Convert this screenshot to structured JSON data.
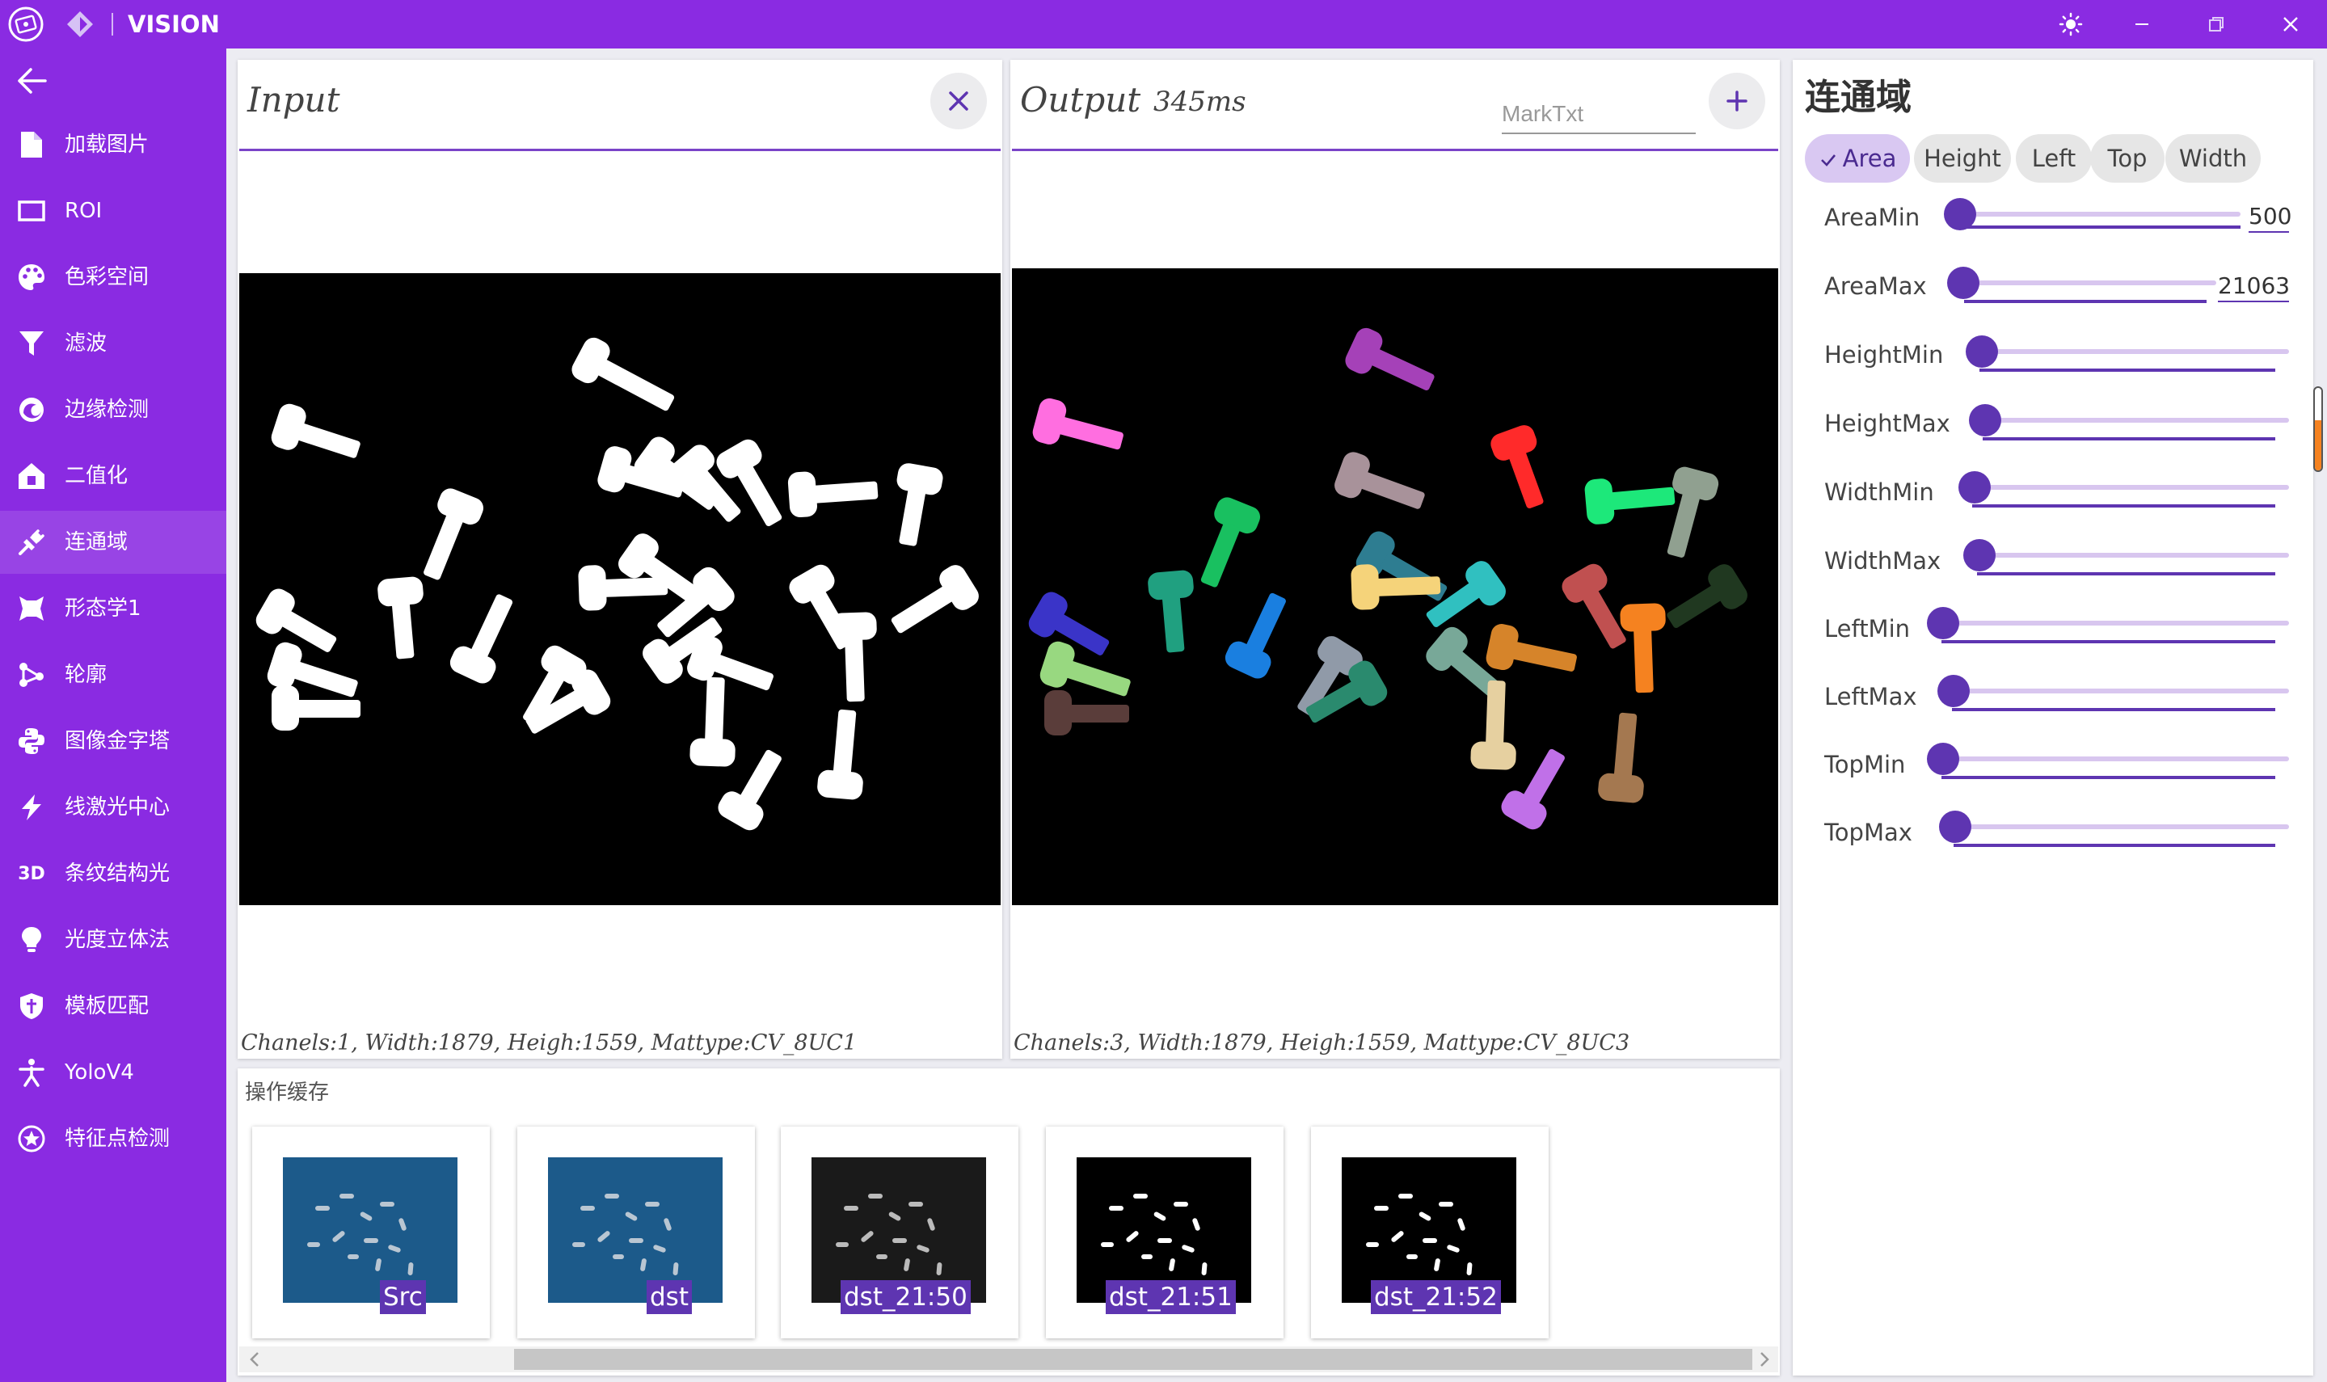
{
  "app": {
    "title": "VISION"
  },
  "sidebar": {
    "items": [
      {
        "label": "加载图片",
        "icon": "file-icon"
      },
      {
        "label": "ROI",
        "icon": "rectangle-icon"
      },
      {
        "label": "色彩空间",
        "icon": "palette-icon"
      },
      {
        "label": "滤波",
        "icon": "filter-icon"
      },
      {
        "label": "边缘检测",
        "icon": "edge-icon"
      },
      {
        "label": "二值化",
        "icon": "home-icon"
      },
      {
        "label": "连通域",
        "icon": "plug-icon"
      },
      {
        "label": "形态学1",
        "icon": "morphology-icon"
      },
      {
        "label": "轮廓",
        "icon": "contour-icon"
      },
      {
        "label": "图像金字塔",
        "icon": "python-icon"
      },
      {
        "label": "线激光中心",
        "icon": "lightning-icon"
      },
      {
        "label": "条纹结构光",
        "icon": "3d-icon",
        "glyph": "3D"
      },
      {
        "label": "光度立体法",
        "icon": "bulb-icon"
      },
      {
        "label": "模板匹配",
        "icon": "shield-icon"
      },
      {
        "label": "YoloV4",
        "icon": "person-icon"
      },
      {
        "label": "特征点检测",
        "icon": "star-circle-icon"
      }
    ],
    "active_index": 6
  },
  "input_panel": {
    "title": "Input",
    "status": "Chanels:1, Width:1879, Heigh:1559, Mattype:CV_8UC1"
  },
  "output_panel": {
    "title": "Output",
    "time": "345ms",
    "mark_placeholder": "MarkTxt",
    "status": "Chanels:3, Width:1879, Heigh:1559, Mattype:CV_8UC3"
  },
  "cache": {
    "title": "操作缓存",
    "items": [
      "Src",
      "dst",
      "dst_21:50",
      "dst_21:51",
      "dst_21:52"
    ]
  },
  "right_panel": {
    "title": "连通域",
    "chips": [
      "Area",
      "Height",
      "Left",
      "Top",
      "Width"
    ],
    "active_chip": "Area",
    "params": [
      {
        "label": "AreaMin",
        "value": "500"
      },
      {
        "label": "AreaMax",
        "value": "21063"
      },
      {
        "label": "HeightMin",
        "value": ""
      },
      {
        "label": "HeightMax",
        "value": ""
      },
      {
        "label": "WidthMin",
        "value": ""
      },
      {
        "label": "WidthMax",
        "value": ""
      },
      {
        "label": "LeftMin",
        "value": ""
      },
      {
        "label": "LeftMax",
        "value": ""
      },
      {
        "label": "TopMin",
        "value": ""
      },
      {
        "label": "TopMax",
        "value": ""
      }
    ]
  },
  "colors": {
    "accent": "#8a2be2",
    "primary": "#5e35b1",
    "track": "#d8c6ef",
    "chip_active": "#d9c8f2",
    "scrollbar_accent": "#f58220"
  }
}
